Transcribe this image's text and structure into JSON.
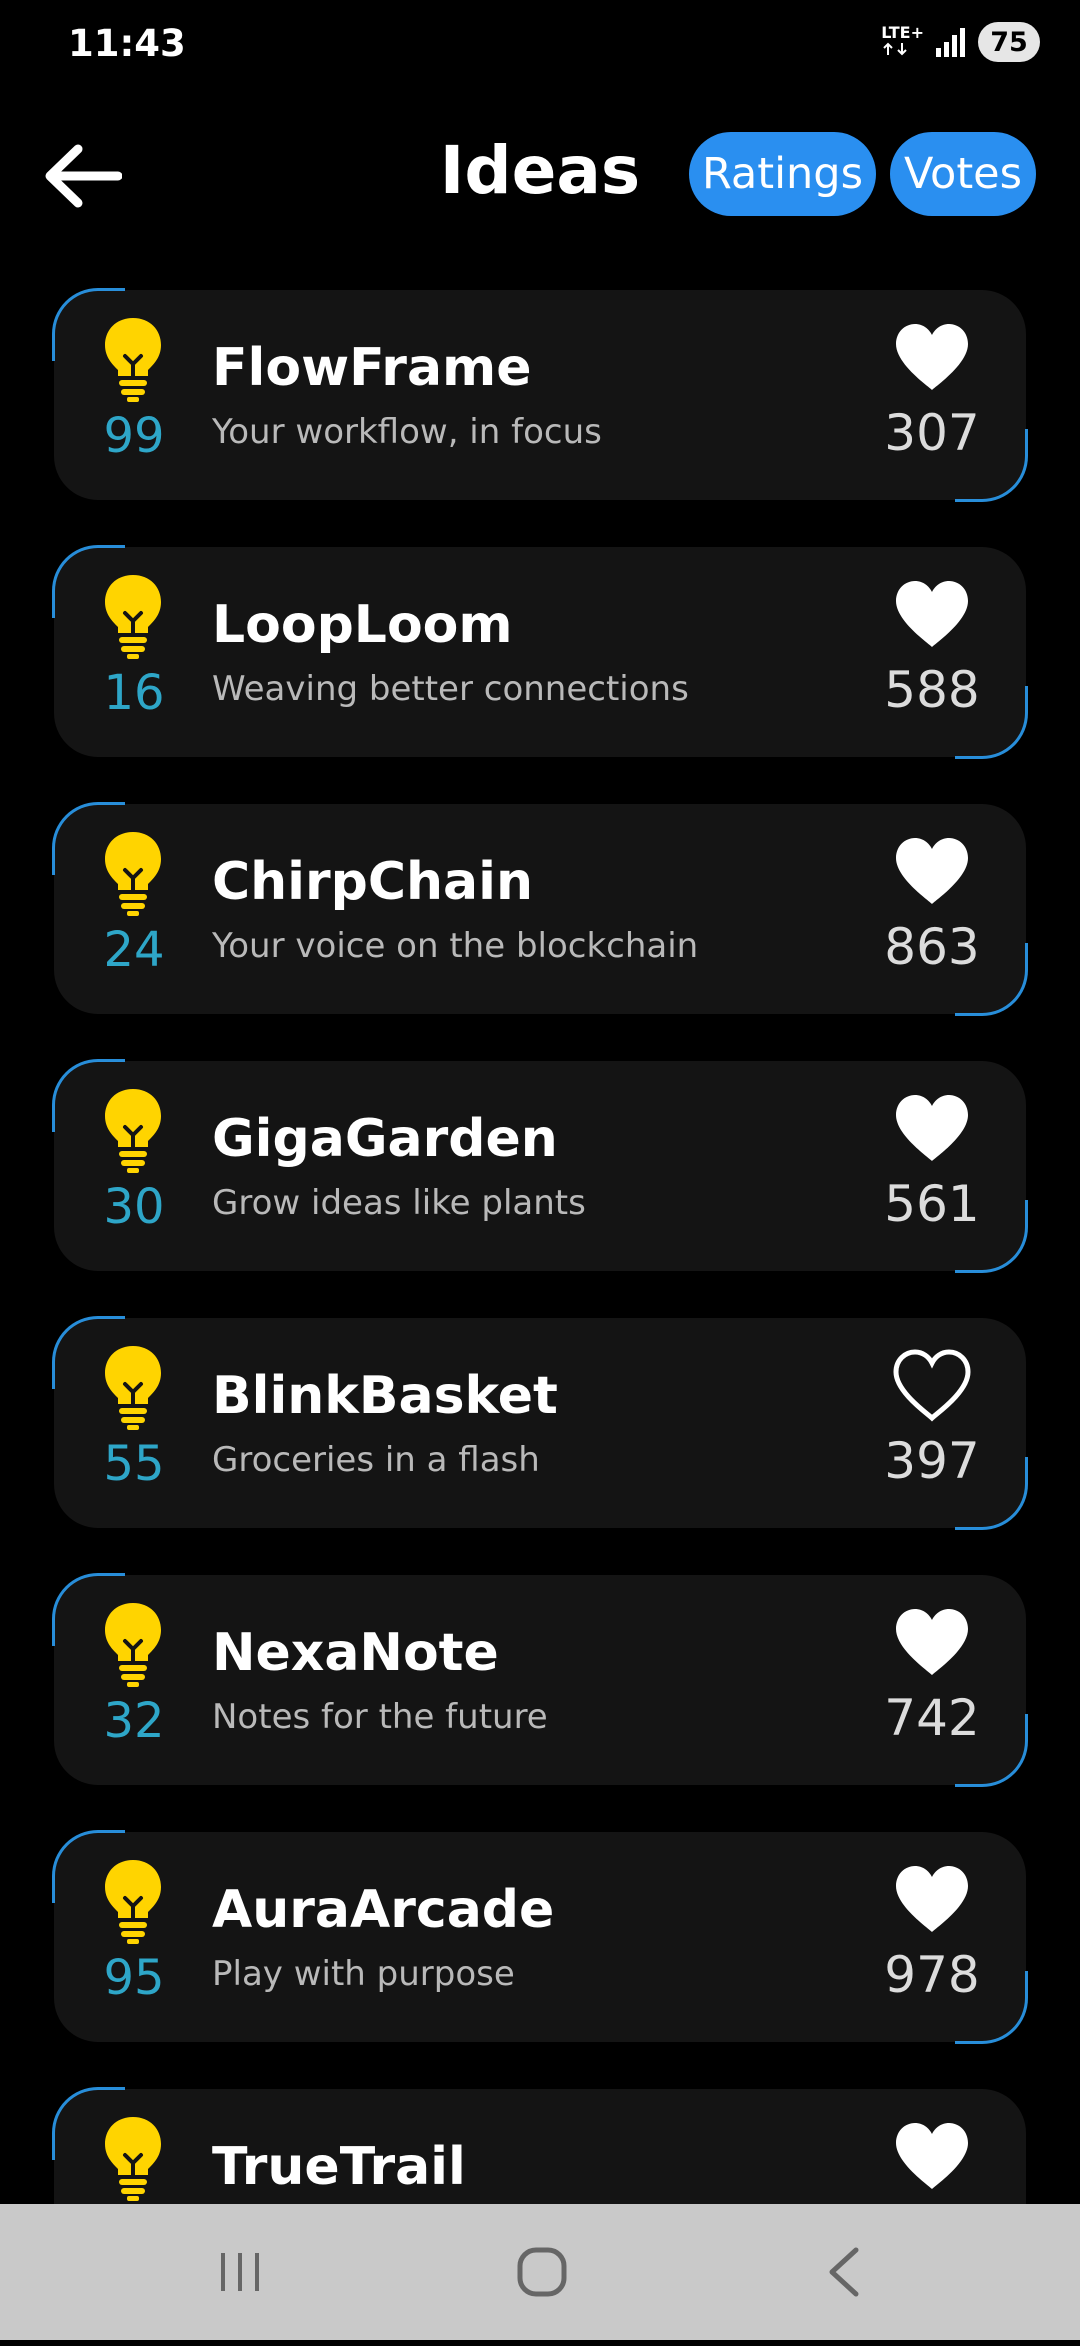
{
  "status_bar": {
    "time": "11:43",
    "network": "LTE+",
    "battery": "75"
  },
  "header": {
    "title": "Ideas",
    "ratings_label": "Ratings",
    "votes_label": "Votes"
  },
  "colors": {
    "accent": "#2a8ff0",
    "bulb": "#ffd400",
    "rating_text": "#2ea6c8",
    "card_bg": "#141414"
  },
  "ideas": [
    {
      "name": "FlowFrame",
      "tagline": "Your workflow, in focus",
      "rating": "99",
      "votes": "307",
      "liked": true
    },
    {
      "name": "LoopLoom",
      "tagline": "Weaving better connections",
      "rating": "16",
      "votes": "588",
      "liked": true
    },
    {
      "name": "ChirpChain",
      "tagline": "Your voice on the blockchain",
      "rating": "24",
      "votes": "863",
      "liked": true
    },
    {
      "name": "GigaGarden",
      "tagline": "Grow ideas like plants",
      "rating": "30",
      "votes": "561",
      "liked": true
    },
    {
      "name": "BlinkBasket",
      "tagline": "Groceries in a flash",
      "rating": "55",
      "votes": "397",
      "liked": false
    },
    {
      "name": "NexaNote",
      "tagline": "Notes for the future",
      "rating": "32",
      "votes": "742",
      "liked": true
    },
    {
      "name": "AuraArcade",
      "tagline": "Play with purpose",
      "rating": "95",
      "votes": "978",
      "liked": true
    },
    {
      "name": "TrueTrail",
      "tagline": "",
      "rating": "",
      "votes": "",
      "liked": true
    }
  ],
  "icons": {
    "back": "arrow-left-icon",
    "idea": "lightbulb-icon",
    "like": "heart-icon",
    "nav_recents": "recents-icon",
    "nav_home": "home-icon",
    "nav_back": "back-chevron-icon"
  }
}
